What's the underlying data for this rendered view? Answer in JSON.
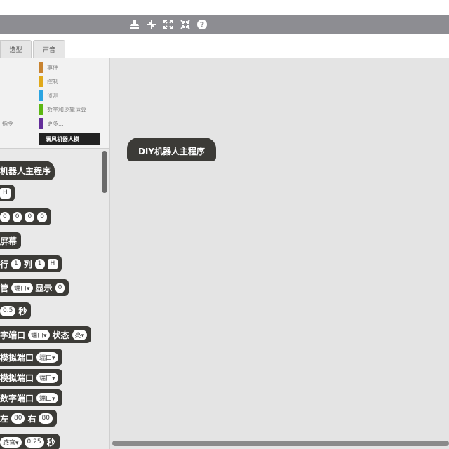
{
  "toolbar": {
    "icons": [
      "stamp-icon",
      "cut-icon",
      "grow-icon",
      "shrink-icon",
      "help-icon"
    ]
  },
  "tabs": [
    {
      "label": ""
    },
    {
      "label": "造型"
    },
    {
      "label": "声音"
    }
  ],
  "categories": [
    {
      "label": "事件",
      "color": "#c88330"
    },
    {
      "label": "控制",
      "color": "#e1a91a"
    },
    {
      "label": "侦测",
      "color": "#2ca5e2"
    },
    {
      "label": "数字和逻辑运算",
      "color": "#5cb712"
    },
    {
      "label": "更多...",
      "color": "#632d99"
    }
  ],
  "categories_left_label": "指令",
  "active_category": "澜风机器人模",
  "blocks": [
    {
      "text": "机器人主程序"
    },
    {
      "text": "",
      "slots": [
        "H"
      ]
    },
    {
      "text": "",
      "slots": [
        "0",
        "0",
        "0",
        "0"
      ]
    },
    {
      "text": "屏幕"
    },
    {
      "text": "行",
      "slots": [
        "1"
      ],
      "text2": "列",
      "slots2": [
        "1",
        "H"
      ]
    },
    {
      "text": "管",
      "slots": [
        "端口▾"
      ],
      "text2": "显示",
      "slots2": [
        "0"
      ]
    },
    {
      "text": "",
      "slots": [
        "0.5"
      ],
      "text2": "秒"
    },
    {
      "text": "字端口",
      "slots": [
        "端口▾"
      ],
      "text2": "状态",
      "slots2": [
        "亮▾"
      ]
    },
    {
      "text": "模拟端口",
      "slots": [
        "端口▾"
      ]
    },
    {
      "text": "模拟端口",
      "slots": [
        "端口▾"
      ]
    },
    {
      "text": "数字端口",
      "slots": [
        "端口▾"
      ]
    },
    {
      "text": "左",
      "slots": [
        "80"
      ],
      "text2": "右",
      "slots2": [
        "80"
      ]
    },
    {
      "text": "",
      "slots": [
        "感官▾",
        "0.25"
      ],
      "text2": "秒"
    }
  ],
  "canvas": {
    "block_label": "DIY机器人主程序"
  }
}
